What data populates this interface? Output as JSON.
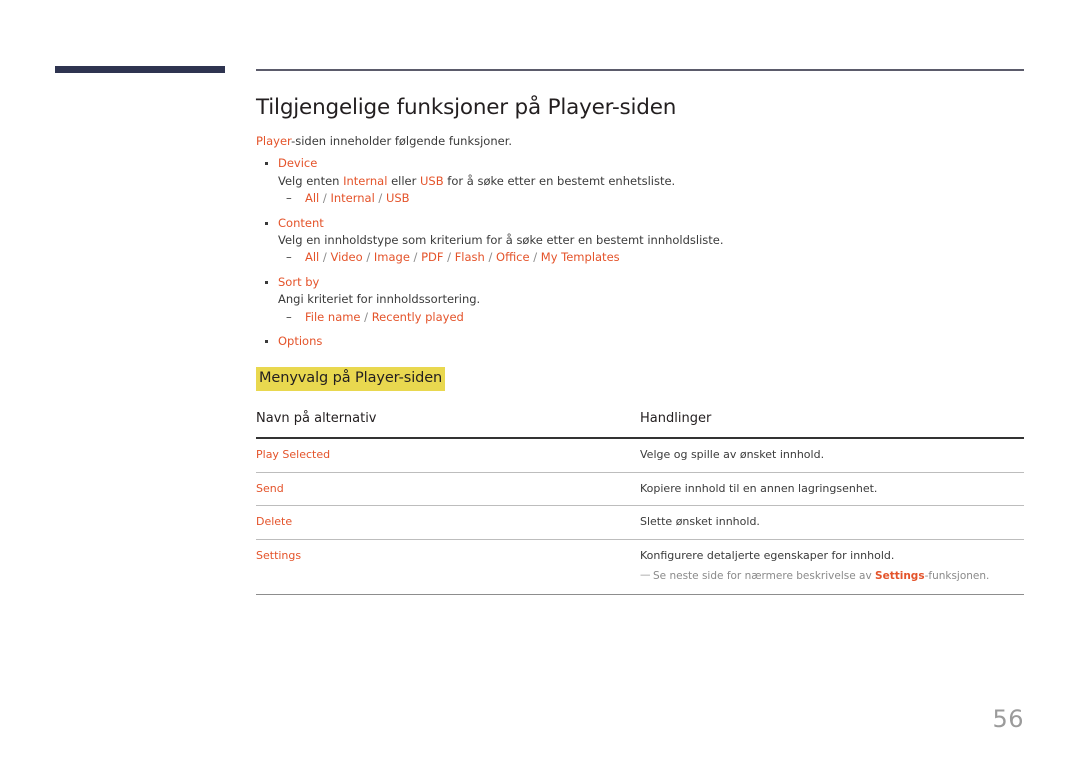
{
  "document": {
    "page_number": "56",
    "accent_color": "#e4532a",
    "highlight_color": "#e9d84f",
    "header_bar_color": "#2e3450",
    "header_line_color": "#5b5b6b",
    "page_number_color": "#9b9b9b"
  },
  "page_title": "Tilgjengelige funksjoner på Player-siden",
  "intro": {
    "keyword": "Player",
    "rest": "-siden inneholder følgende funksjoner."
  },
  "features": [
    {
      "name": "Device",
      "description": {
        "part1": "Velg enten ",
        "kw1": "Internal",
        "part2": " eller ",
        "kw2": "USB",
        "part3": " for å søke etter en bestemt enhetsliste."
      },
      "options": [
        "All",
        "Internal",
        "USB"
      ]
    },
    {
      "name": "Content",
      "description": {
        "part1": "Velg en innholdstype som kriterium for å søke etter en bestemt innholdsliste.",
        "kw1": "",
        "part2": "",
        "kw2": "",
        "part3": ""
      },
      "options": [
        "All",
        "Video",
        "Image",
        "PDF",
        "Flash",
        "Office",
        "My Templates"
      ]
    },
    {
      "name": "Sort by",
      "description": {
        "part1": "Angi kriteriet for innholdssortering.",
        "kw1": "",
        "part2": "",
        "kw2": "",
        "part3": ""
      },
      "options": [
        "File name",
        "Recently played"
      ]
    },
    {
      "name": "Options",
      "description": null,
      "options": []
    }
  ],
  "section_heading": "Menyvalg på Player-siden",
  "table": {
    "headers": [
      "Navn på alternativ",
      "Handlinger"
    ],
    "rows": [
      {
        "name": "Play Selected",
        "action": "Velge og spille av ønsket innhold.",
        "note": null
      },
      {
        "name": "Send",
        "action": "Kopiere innhold til en annen lagringsenhet.",
        "note": null
      },
      {
        "name": "Delete",
        "action": "Slette ønsket innhold.",
        "note": null
      },
      {
        "name": "Settings",
        "action": "Konfigurere detaljerte egenskaper for innhold.",
        "note": {
          "dash": "—",
          "before": "Se neste side for nærmere beskrivelse av ",
          "keyword": "Settings",
          "after": "-funksjonen."
        }
      }
    ]
  }
}
